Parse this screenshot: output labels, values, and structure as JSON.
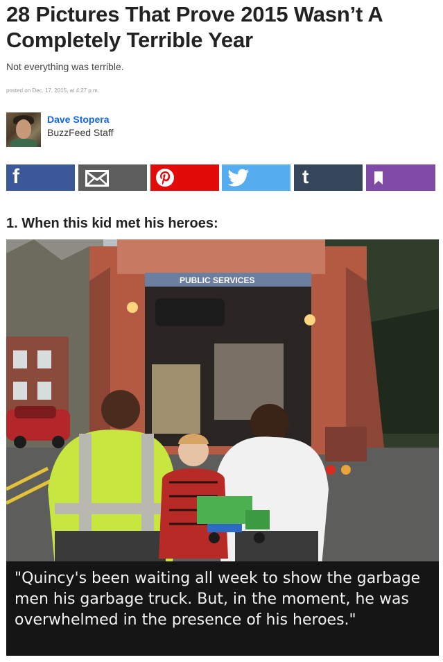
{
  "article": {
    "title": "28 Pictures That Prove 2015 Wasn’t A Completely Terrible Year",
    "subtitle": "Not everything was terrible.",
    "posted": "posted on Dec. 17, 2015, at 4:27 p.m."
  },
  "author": {
    "name": "Dave Stopera",
    "role": "BuzzFeed Staff"
  },
  "share_buttons": [
    {
      "name": "facebook",
      "glyph": "f",
      "color": "#3b5998"
    },
    {
      "name": "email",
      "icon": "envelope-icon",
      "color": "#5d5d5d"
    },
    {
      "name": "pinterest",
      "icon": "pinterest-icon",
      "color": "#e30a0a"
    },
    {
      "name": "twitter",
      "icon": "bird-icon",
      "color": "#55acee"
    },
    {
      "name": "tumblr",
      "glyph": "t",
      "color": "#35465c"
    },
    {
      "name": "bookmark",
      "icon": "bookmark-icon",
      "color": "#7f4aa6"
    }
  ],
  "item": {
    "heading": "1. When this kid met his heroes:",
    "truck_sign": "PUBLIC SERVICES",
    "caption": "\"Quincy's been waiting all week to show the garbage men his garbage truck. But, in the moment, he was overwhelmed in the presence of his heroes.\""
  }
}
